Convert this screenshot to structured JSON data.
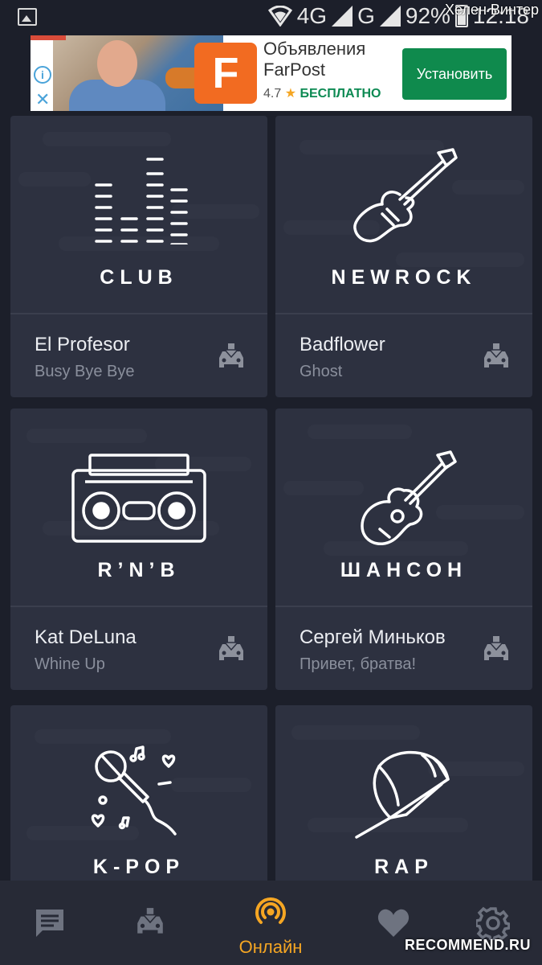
{
  "statusbar": {
    "network": "4G",
    "network2": "G",
    "battery": "92%",
    "time": "12:18",
    "watermark": "Хелен Винтер"
  },
  "ad": {
    "title_line1": "Объявления",
    "title_line2": "FarPost",
    "logo_letter": "F",
    "rating": "4.7",
    "price": "БЕСПЛАТНО",
    "install_label": "Установить"
  },
  "cards": [
    {
      "genre": "CLUB",
      "artist": "El Profesor",
      "track": "Busy Bye Bye"
    },
    {
      "genre": "NEWROCK",
      "artist": "Badflower",
      "track": "Ghost"
    },
    {
      "genre": "R’N’B",
      "artist": "Kat DeLuna",
      "track": "Whine Up"
    },
    {
      "genre": "ШАНСОН",
      "artist": "Сергей Миньков",
      "track": "Привет, братва!"
    },
    {
      "genre": "K-POP",
      "artist": "",
      "track": ""
    },
    {
      "genre": "RAP",
      "artist": "",
      "track": ""
    }
  ],
  "nav": {
    "online_label": "Онлайн",
    "active_color": "#f5a623",
    "inactive_color": "#6e7380"
  },
  "watermark_bottom": "RECOMMEND.RU"
}
